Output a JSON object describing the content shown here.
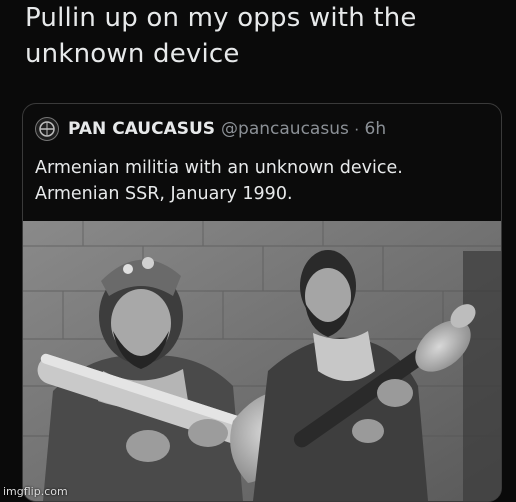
{
  "tweet": {
    "line1": "Pullin up on my opps with the",
    "line2": "unknown device"
  },
  "quoted_tweet": {
    "author_name": "PAN CAUCASUS",
    "handle": "@pancaucasus",
    "separator": "·",
    "time": "6h",
    "line1": "Armenian militia with an unknown device.",
    "line2": "Armenian SSR, January 1990."
  },
  "watermark": "imgflip.com"
}
